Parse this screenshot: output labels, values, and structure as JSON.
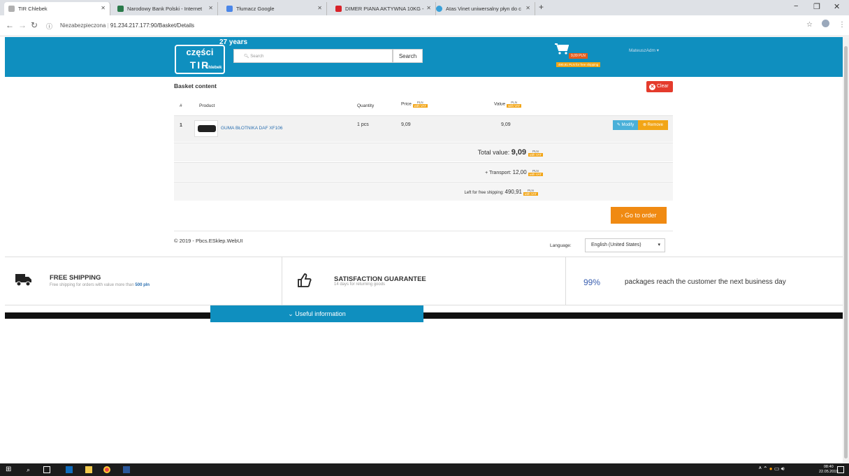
{
  "browser": {
    "tabs": [
      {
        "label": "TIR Chlebek",
        "active": true,
        "fav_color": "#b0b0b0"
      },
      {
        "label": "Narodowy Bank Polski - Internet",
        "active": false,
        "fav_color": "#2a7a4a"
      },
      {
        "label": "Tłumacz Google",
        "active": false,
        "fav_color": "#4a86e8"
      },
      {
        "label": "DIMER PIANA AKTYWNA 10KG -",
        "active": false,
        "fav_color": "#d8232a"
      },
      {
        "label": "Atas Vinet uniwersalny płyn do c",
        "active": false,
        "fav_color": "#3aa0d8"
      }
    ],
    "new_tab": "+",
    "security_label": "Niezabezpieczona",
    "url": "91.234.217.177:90/Basket/Details"
  },
  "header": {
    "logo_top": "części",
    "logo_bottom": "TIR",
    "logo_sub": "Chlebek",
    "years": "27 years",
    "search_placeholder": "Search",
    "search_button": "Search",
    "cart_value": "9,09 PLN",
    "free_shipping_badge": "490,91 PLN for free shipping",
    "user": "MateuszAdm"
  },
  "basket": {
    "title": "Basket content",
    "clear_label": "Clear",
    "columns": {
      "num": "#",
      "product": "Product",
      "quantity": "Quantity",
      "price": "Price",
      "value": "Value"
    },
    "currency_tag": "PLN",
    "vat_tag": "with VAT",
    "rows": [
      {
        "num": "1",
        "product": "GUMA BŁOTNIKA DAF XF106",
        "quantity": "1 pcs",
        "price": "9,09",
        "value": "9,09"
      }
    ],
    "modify_label": "Modify",
    "remove_label": "Remove",
    "total_label": "Total value:",
    "total_value": "9,09",
    "transport_label": "+ Transport:",
    "transport_value": "12,00",
    "left_label": "Left for free shipping:",
    "left_value": "490,91",
    "go_to_order": "Go to order"
  },
  "footer": {
    "copyright": "© 2019 - Pbcs.ESklep.WebUI",
    "language_label": "Language:",
    "language_value": "English (United States)"
  },
  "features": {
    "shipping_title": "FREE SHIPPING",
    "shipping_sub": "Free shipping for orders with value more than",
    "shipping_amount": "500 pln",
    "guarantee_title": "SATISFACTION GUARANTEE",
    "guarantee_sub": "14 days for returning goods",
    "percent": "99%",
    "percent_text": "packages reach the customer the next business day"
  },
  "useful_info": "Useful information",
  "taskbar": {
    "time": "08:40",
    "date": "22.05.2019"
  }
}
